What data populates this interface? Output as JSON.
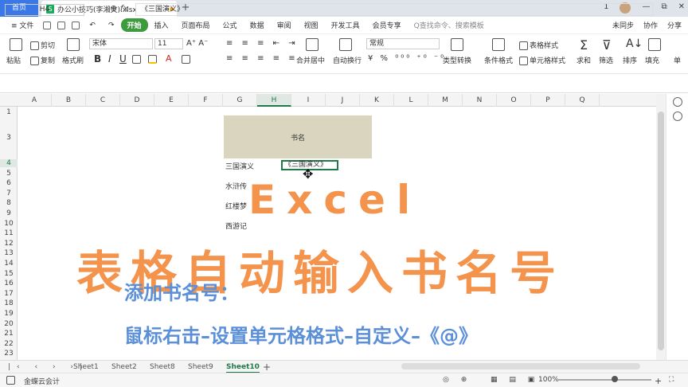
{
  "tabbar": {
    "home_tab": "首页",
    "file_tab": "办公小技巧(李湘文).xlsx",
    "file_icon": "S"
  },
  "window": {
    "controls": [
      "1",
      "—",
      "⧉",
      "✕"
    ]
  },
  "menu": {
    "file": "≡ 文件",
    "start": "开始",
    "items": [
      "插入",
      "页面布局",
      "公式",
      "数据",
      "审阅",
      "视图",
      "开发工具",
      "会员专享"
    ],
    "search": "Q查找命令、搜索模板",
    "right": [
      "未同步",
      "协作",
      "分享"
    ]
  },
  "toolbar": {
    "paste": "粘贴",
    "cut": "剪切",
    "copy": "复制",
    "format_painter": "格式刷",
    "font_name": "宋体",
    "font_size": "11",
    "bold": "B",
    "italic": "I",
    "underline": "U",
    "merge_center": "合并居中",
    "wrap": "自动换行",
    "number_format": "常规",
    "type_convert": "类型转换",
    "cond_format": "条件格式",
    "table_style": "表格样式",
    "cell_style": "单元格样式",
    "sum": "求和",
    "filter": "筛选",
    "sort": "排序",
    "fill": "填充",
    "more": "单"
  },
  "formula_bar": {
    "name_box": "H4",
    "fx_label": "fx",
    "content": "《三国演义》"
  },
  "grid": {
    "columns": [
      "A",
      "B",
      "C",
      "D",
      "E",
      "F",
      "G",
      "H",
      "I",
      "J",
      "K",
      "L",
      "M",
      "N",
      "O",
      "P",
      "Q"
    ],
    "rows": [
      "1",
      "3",
      "4",
      "5",
      "6",
      "7",
      "8",
      "9",
      "10",
      "11",
      "12",
      "13",
      "14",
      "15",
      "16",
      "17",
      "18",
      "19",
      "20",
      "21",
      "22",
      "23"
    ],
    "header_cell": "书名",
    "books": [
      "三国演义",
      "水浒传",
      "红楼梦",
      "西游记"
    ],
    "selected_value": "《三国演义》"
  },
  "overlay": {
    "title_excel": "Excel",
    "title_main": "表格自动输入书名号",
    "subtitle1": "添加书名号：",
    "subtitle2": "鼠标右击–设置单元格格式–自定义–《@》"
  },
  "sheet_tabs": [
    "Sheet1",
    "Sheet2",
    "Sheet8",
    "Sheet9",
    "Sheet10"
  ],
  "active_sheet": "Sheet10",
  "status": {
    "cloud": "金蝶云会计",
    "zoom": "100%",
    "zoom_level": 1.0
  },
  "colors": {
    "accent_green": "#1f7a4a",
    "header_fill": "#d9d5bf",
    "title_orange": "#f4944c",
    "subtitle_blue": "#5b8fd8"
  }
}
